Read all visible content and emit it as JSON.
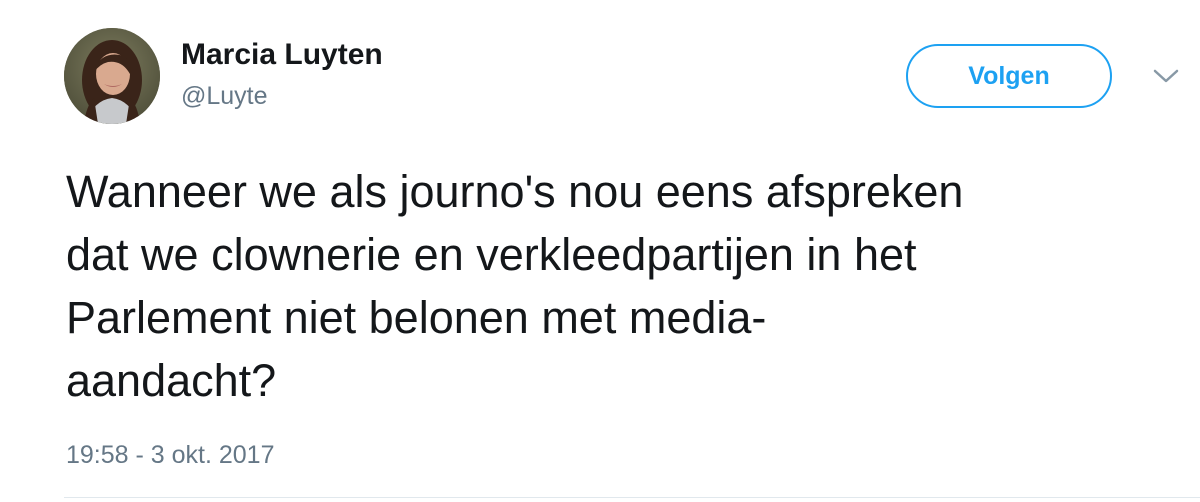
{
  "user": {
    "display_name": "Marcia Luyten",
    "handle": "@Luyte"
  },
  "actions": {
    "follow_label": "Volgen",
    "menu_icon": "chevron-down-icon"
  },
  "tweet": {
    "text": "Wanneer we als journo's nou eens afspreken\ndat we clownerie en verkleedpartijen in het\nParlement niet belonen met media-\naandacht?",
    "timestamp": "19:58 - 3 okt. 2017"
  },
  "colors": {
    "accent": "#1da1f2",
    "primary_text": "#14171a",
    "secondary_text": "#657786",
    "divider": "#e1e8ed"
  }
}
